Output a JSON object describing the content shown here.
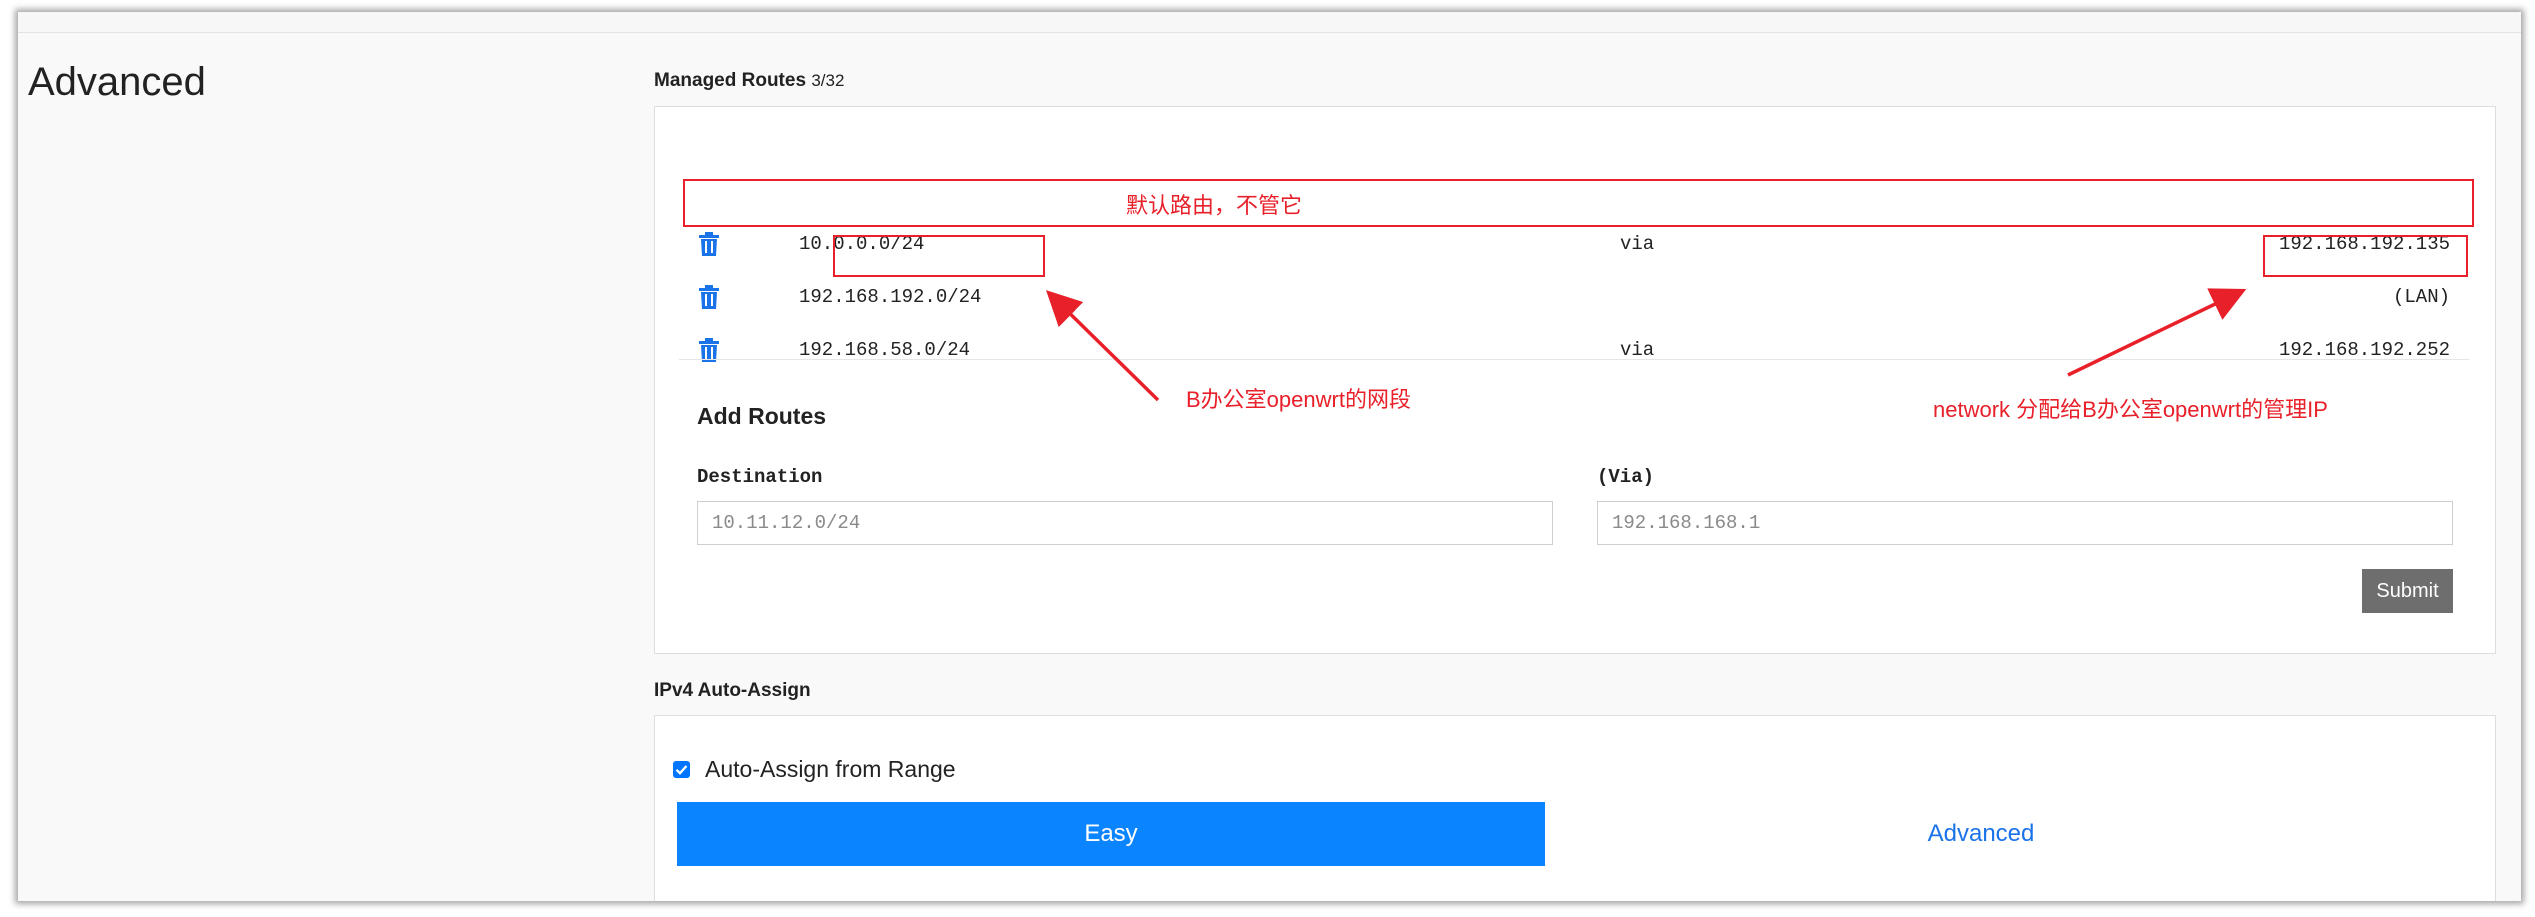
{
  "page": {
    "heading": "Advanced"
  },
  "managed_routes": {
    "title": "Managed Routes",
    "count": "3/32",
    "routes": [
      {
        "destination": "10.0.0.0/24",
        "via": "via",
        "gateway": "192.168.192.135"
      },
      {
        "destination": "192.168.192.0/24",
        "via": "",
        "gateway": "(LAN)"
      },
      {
        "destination": "192.168.58.0/24",
        "via": "via",
        "gateway": "192.168.192.252"
      }
    ]
  },
  "add_routes": {
    "title": "Add Routes",
    "destination_label": "Destination",
    "destination_placeholder": "10.11.12.0/24",
    "via_label": "(Via)",
    "via_placeholder": "192.168.168.1",
    "submit_label": "Submit"
  },
  "ipv4": {
    "title": "IPv4 Auto-Assign",
    "auto_assign_label": "Auto-Assign from Range",
    "auto_assign_checked": true,
    "tabs": [
      "Easy",
      "Advanced"
    ]
  },
  "annotations": {
    "default_route_note": "默认路由，不管它",
    "subnet_note": "B办公室openwrt的网段",
    "gateway_note": "network 分配给B办公室openwrt的管理IP"
  },
  "colors": {
    "accent": "#0a84ff",
    "annotation": "#e8202a",
    "trash_icon": "#1a73e8",
    "submit_bg": "#6e6e6e"
  },
  "icons": {
    "delete": "trash-icon"
  }
}
